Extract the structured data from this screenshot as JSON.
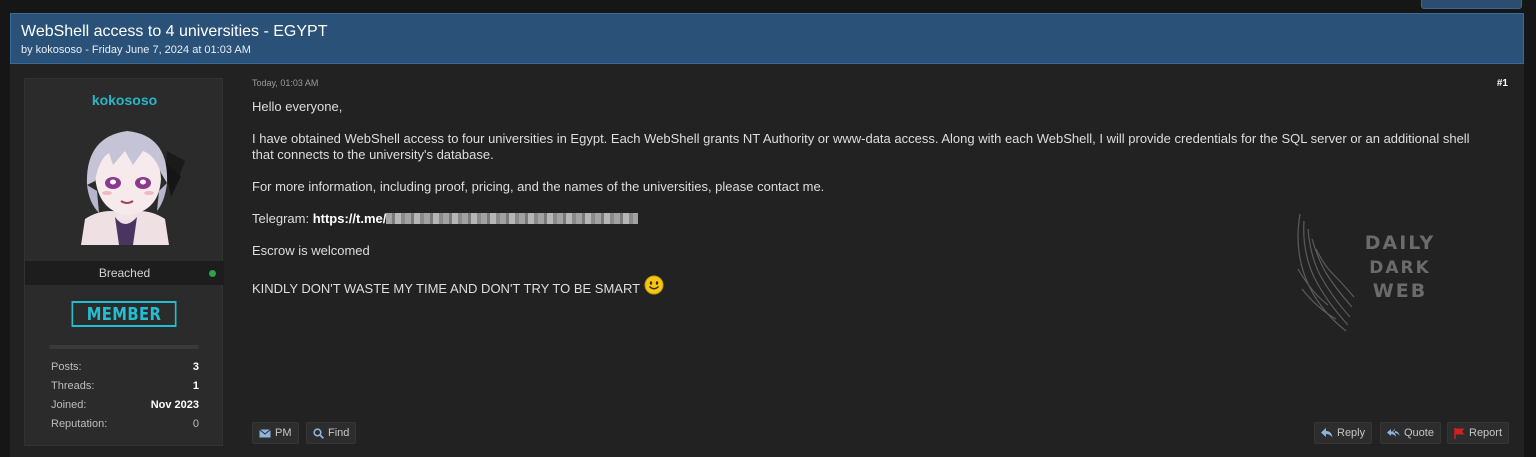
{
  "thread": {
    "title": "WebShell access to 4 universities - EGYPT",
    "byline": "by kokososo - Friday June 7, 2024 at 01:03 AM"
  },
  "author": {
    "username": "kokososo",
    "group": "Breached",
    "rank_badge": "MEMBER",
    "stats": [
      {
        "label": "Posts:",
        "value": "3"
      },
      {
        "label": "Threads:",
        "value": "1"
      },
      {
        "label": "Joined:",
        "value": "Nov 2023"
      },
      {
        "label": "Reputation:",
        "value": "0"
      }
    ]
  },
  "post": {
    "date": "Today, 01:03 AM",
    "number": "#1",
    "greeting": "Hello everyone,",
    "paragraph1": "I have obtained WebShell access to four universities in Egypt. Each WebShell grants NT Authority or www-data access. Along with each WebShell, I will provide credentials for the SQL server or an additional shell that connects to the university's database.",
    "paragraph2": "For more information, including proof, pricing, and the names of the universities, please contact me.",
    "telegram_label": "Telegram: ",
    "telegram_link": "https://t.me/",
    "escrow": "Escrow is welcomed",
    "warning": "KINDLY DON'T WASTE MY TIME AND DON'T TRY TO BE SMART"
  },
  "watermark": {
    "line1": "DAILY",
    "line2": "DARK",
    "line3": "WEB"
  },
  "actions": {
    "pm": "PM",
    "find": "Find",
    "reply": "Reply",
    "quote": "Quote",
    "report": "Report"
  },
  "colors": {
    "header_bg": "#2a5278",
    "username": "#2ab6c6",
    "badge": "#23bfd0",
    "online": "#2fa14a",
    "report_flag": "#d02020"
  }
}
